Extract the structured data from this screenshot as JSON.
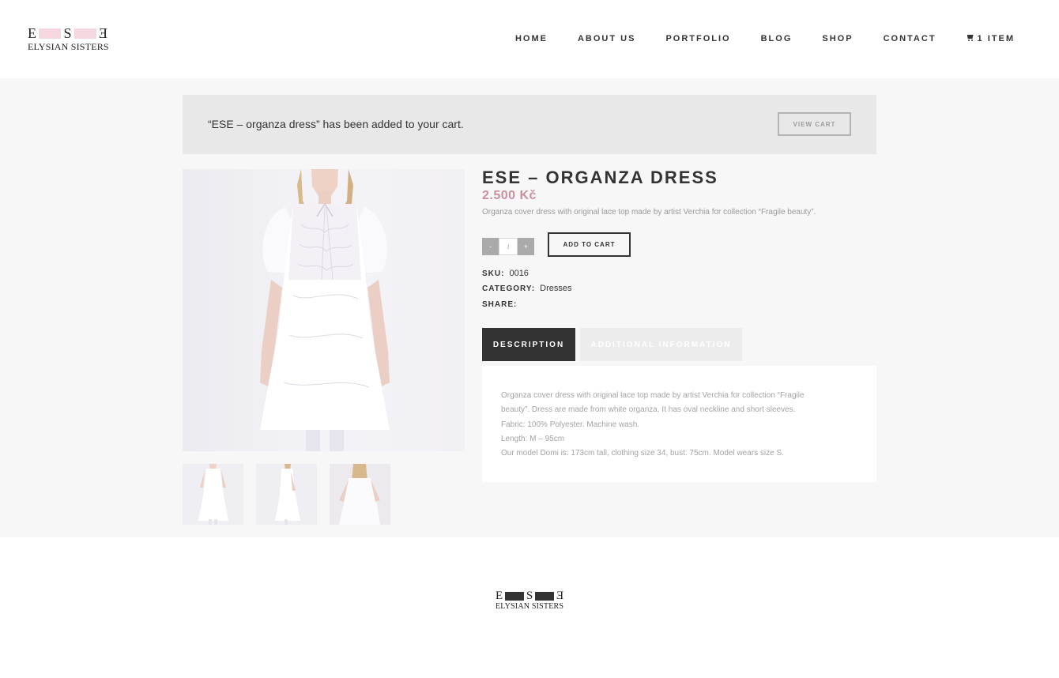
{
  "brand": {
    "letter_left": "E",
    "letter_middle": "S",
    "letter_right": "E",
    "name": "ELYSIAN SISTERS",
    "accent_color": "#f5d8df"
  },
  "nav": {
    "items": [
      {
        "label": "HOME"
      },
      {
        "label": "ABOUT US"
      },
      {
        "label": "PORTFOLIO"
      },
      {
        "label": "BLOG"
      },
      {
        "label": "SHOP"
      },
      {
        "label": "CONTACT"
      }
    ],
    "cart_label": "1 ITEM",
    "cart_icon": "shopping-cart-icon"
  },
  "notice": {
    "message": "“ESE – organza dress” has been added to your cart.",
    "button_label": "VIEW CART"
  },
  "product": {
    "title": "ESE – ORGANZA DRESS",
    "price": "2.500 Kč",
    "price_color": "#c9919e",
    "short_description": "Organza cover dress with original lace top made by artist Verchia for collection “Fragile beauty”.",
    "quantity": "1",
    "minus_label": "-",
    "plus_label": "+",
    "add_to_cart_label": "ADD TO CART",
    "sku_label": "SKU:",
    "sku_value": "0016",
    "category_label": "CATEGORY:",
    "category_value": "Dresses",
    "share_label": "SHARE:"
  },
  "tabs": [
    {
      "label": "DESCRIPTION",
      "active": true
    },
    {
      "label": "ADDITIONAL INFORMATION",
      "active": false
    }
  ],
  "description": {
    "lines": [
      "Organza cover dress with original lace top made by artist Verchia for collection “Fragile",
      "beauty”. Dress are made from white organza. It has oval neckline and short sleeves.",
      "Fabric: 100% Polyester. Machine wash.",
      "Length: M – 95cm",
      "Our model Domi is: 173cm tall, clothing size 34, bust: 75cm. Model wears size S."
    ]
  },
  "footer": {
    "letter_left": "E",
    "letter_middle": "S",
    "letter_right": "E",
    "name": "ELYSIAN SISTERS"
  }
}
